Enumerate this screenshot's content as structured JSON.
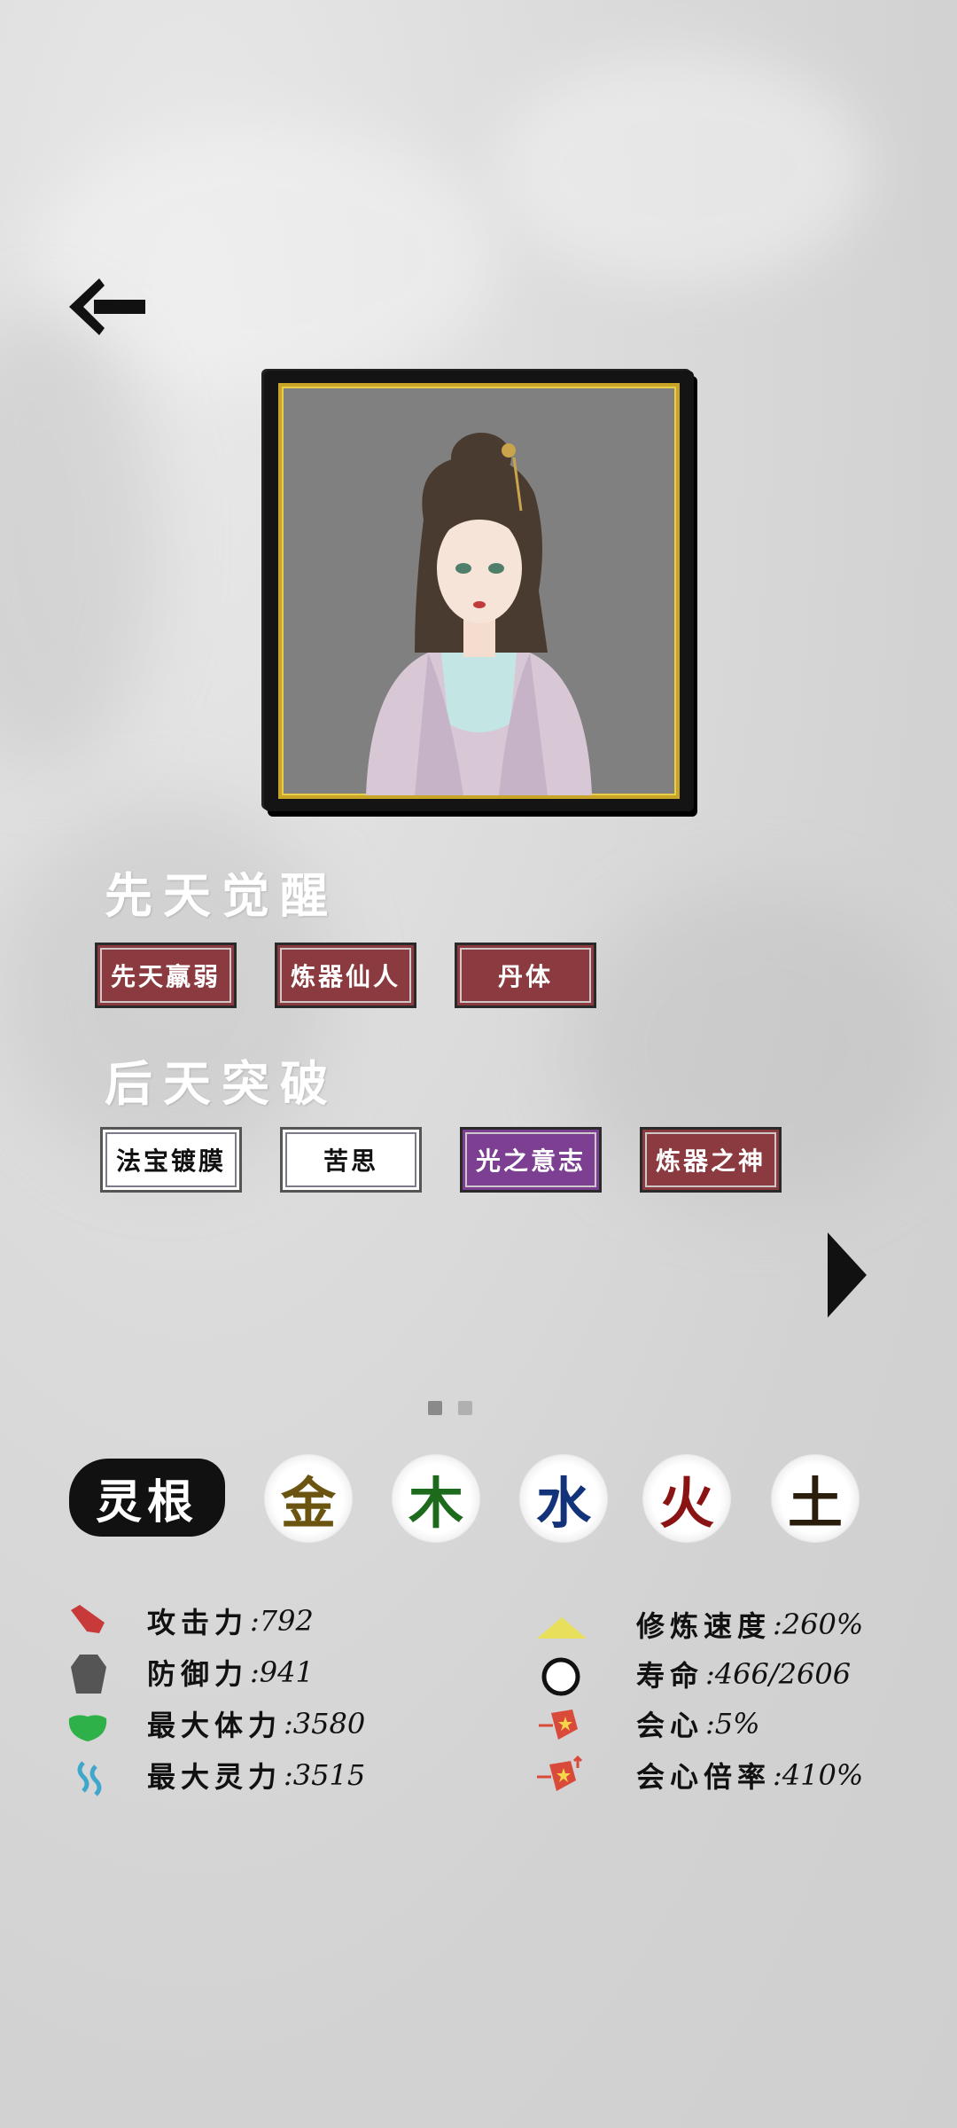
{
  "awakening": {
    "title": "先天觉醒",
    "tags": [
      {
        "label": "先天羸弱",
        "style": "red"
      },
      {
        "label": "炼器仙人",
        "style": "red"
      },
      {
        "label": "丹体",
        "style": "red"
      }
    ]
  },
  "breakthrough": {
    "title": "后天突破",
    "tags": [
      {
        "label": "法宝镀膜",
        "style": "white"
      },
      {
        "label": "苦思",
        "style": "white"
      },
      {
        "label": "光之意志",
        "style": "purple"
      },
      {
        "label": "炼器之神",
        "style": "red"
      }
    ]
  },
  "pager": {
    "pages": 2,
    "current": 1
  },
  "spirit_root": {
    "label": "灵根",
    "elements": [
      {
        "char": "金",
        "color": "#6b5410",
        "icon": "metal-element"
      },
      {
        "char": "木",
        "color": "#1d6a1d",
        "icon": "wood-element"
      },
      {
        "char": "水",
        "color": "#12327a",
        "icon": "water-element"
      },
      {
        "char": "火",
        "color": "#8a1414",
        "icon": "fire-element"
      },
      {
        "char": "土",
        "color": "#2a1d0c",
        "icon": "earth-element"
      }
    ]
  },
  "stats_left": [
    {
      "label": "攻击力",
      "value": ":792",
      "icon": "attack-icon",
      "color": "#c83a3a"
    },
    {
      "label": "防御力",
      "value": ":941",
      "icon": "defense-icon",
      "color": "#555555"
    },
    {
      "label": "最大体力",
      "value": ":3580",
      "icon": "stamina-icon",
      "color": "#2fb14a"
    },
    {
      "label": "最大灵力",
      "value": ":3515",
      "icon": "spirit-power-icon",
      "color": "#3fa6cc"
    }
  ],
  "stats_right": [
    {
      "label": "修炼速度",
      "value": ":260%",
      "icon": "cultivation-speed-icon",
      "color": "#e8df5a"
    },
    {
      "label": "寿命",
      "value": ":466/2606",
      "icon": "lifespan-icon",
      "color": "#111111"
    },
    {
      "label": "会心",
      "value": ":5%",
      "icon": "critical-icon",
      "color": "#d94a3a"
    },
    {
      "label": "会心倍率",
      "value": ":410%",
      "icon": "critical-multiplier-icon",
      "color": "#d94a3a"
    }
  ]
}
